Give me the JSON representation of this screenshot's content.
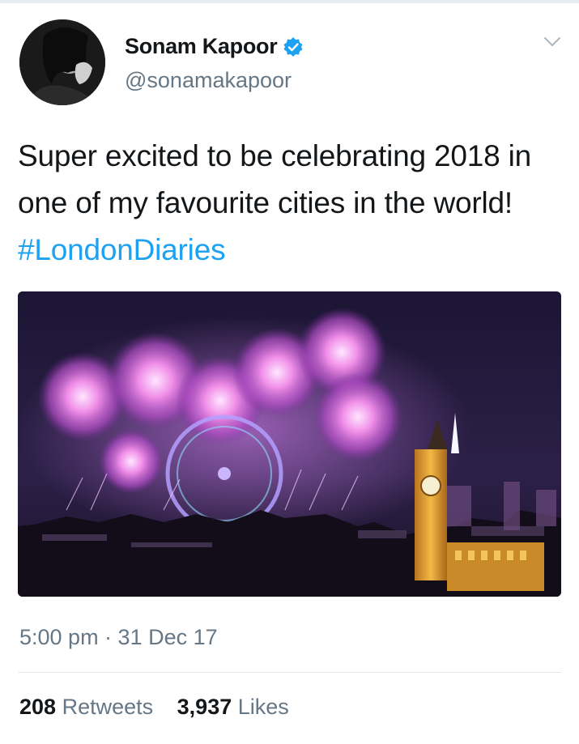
{
  "user": {
    "name": "Sonam Kapoor",
    "handle": "@sonamakapoor"
  },
  "tweet": {
    "text": "Super excited to be celebrating 2018 in one of my favourite cities in the world! ",
    "hashtag": "#LondonDiaries",
    "timestamp": "5:00 pm · 31 Dec 17"
  },
  "stats": {
    "retweets_count": "208",
    "retweets_label": "Retweets",
    "likes_count": "3,937",
    "likes_label": "Likes"
  },
  "icons": {
    "verified": "verified-badge-icon",
    "more": "chevron-down-icon"
  },
  "colors": {
    "accent": "#1da1f2",
    "secondary_text": "#657786",
    "primary_text": "#14171a"
  }
}
